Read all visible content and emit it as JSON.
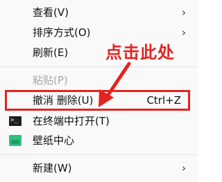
{
  "menu": {
    "items": [
      {
        "label": "查看(V)",
        "submenu": true
      },
      {
        "label": "排序方式(O)",
        "submenu": true
      },
      {
        "label": "刷新(E)"
      },
      {
        "label": "粘贴(P)",
        "disabled": true
      },
      {
        "label": "撤消 删除(U)",
        "shortcut": "Ctrl+Z",
        "highlighted": true
      },
      {
        "label": "在终端中打开(T)",
        "icon": "terminal-icon"
      },
      {
        "label": "壁纸中心",
        "icon": "wallpaper-icon"
      },
      {
        "label": "新建(W)",
        "submenu": true
      }
    ],
    "chevron": "›",
    "terminal_prompt": ">_"
  },
  "annotation": {
    "text": "点击此处",
    "color": "#e5231f"
  }
}
